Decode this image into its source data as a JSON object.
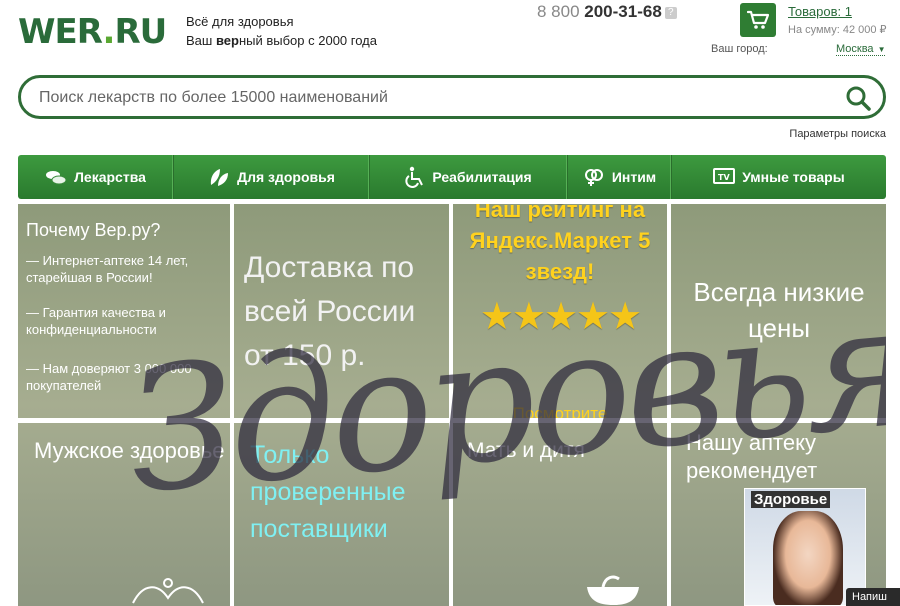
{
  "header": {
    "logo_main": "WER",
    "logo_dot": ".",
    "logo_tld": "RU",
    "tagline_line1": "Всё для здоровья",
    "tagline_line2_pre": "Ваш ",
    "tagline_line2_bold": "вер",
    "tagline_line2_post": "ный выбор с 2000 года",
    "phone_prefix": "8 800 ",
    "phone_number": "200-31-68",
    "phone_help": "?",
    "cart_count": "Товаров: 1",
    "cart_sum": "На сумму: 42 000 ₽",
    "city_label": "Ваш город:",
    "city_value": "Москва"
  },
  "search": {
    "placeholder": "Поиск лекарств по более 15000 наименований",
    "params_link": "Параметры поиска"
  },
  "nav": {
    "items": [
      {
        "label": "Лекарства",
        "icon": "pills-icon"
      },
      {
        "label": "Для здоровья",
        "icon": "leaves-icon"
      },
      {
        "label": "Реабилитация",
        "icon": "wheelchair-icon"
      },
      {
        "label": "Интим",
        "icon": "gender-icon"
      },
      {
        "label": "Умные товары",
        "icon": "tv-icon"
      }
    ]
  },
  "tiles": {
    "why": {
      "title": "Почему Вер.ру?",
      "p1": "— Интернет-аптеке 14 лет, старейшая в России!",
      "p2": "— Гарантия качества и конфиденциальности",
      "p3": "— Нам доверяют 3 000 000 покупателей"
    },
    "delivery": "Доставка по всей России от 150 р.",
    "rating": {
      "text": "Наш рейтинг на Яндекс.Маркет 5 звезд!",
      "stars": "★★★★★",
      "more": "Посмотрите"
    },
    "prices": "Всегда низкие цены",
    "men": "Мужское здоровье",
    "suppliers": "Только проверенные поставщики",
    "mother": "Мать и дитя",
    "recommend": "Нашу аптеку рекомендует",
    "magazine_title": "Здоровье",
    "script_overlay": "Здоровья"
  },
  "chat_label": "Напиш",
  "colors": {
    "brand_green": "#2f7d33",
    "accent_yellow": "#ffd21e",
    "cyan_text": "#7ff0f2"
  }
}
